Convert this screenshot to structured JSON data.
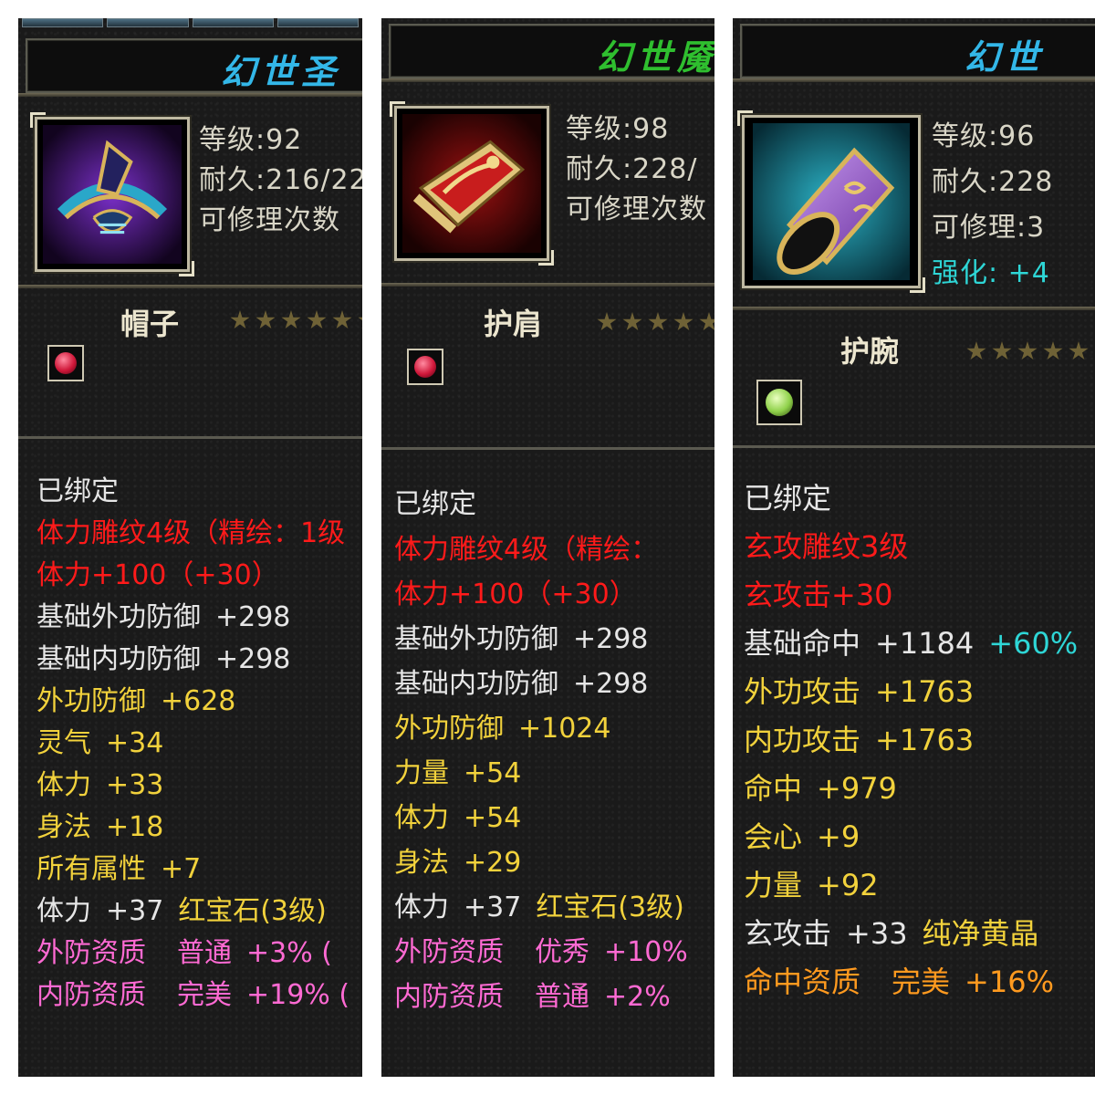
{
  "panels": [
    {
      "title": "幻世圣",
      "title_color": "#33b7e8",
      "level": "等级:92",
      "durability": "耐久:216/22",
      "repair": "可修理次数",
      "slot": "帽子",
      "gem_color": "#d0183a",
      "bind": "已绑定",
      "attrs": [
        {
          "name": "体力雕纹4级（精绘：1级",
          "value": "",
          "extra": "",
          "color": "red"
        },
        {
          "name": "体力+100（+30）",
          "value": "",
          "extra": "",
          "color": "red"
        },
        {
          "name": "基础外功防御",
          "value": "+298",
          "extra": "",
          "color": "white"
        },
        {
          "name": "基础内功防御",
          "value": "+298",
          "extra": "",
          "color": "white"
        },
        {
          "name": "外功防御",
          "value": "+628",
          "extra": "",
          "color": "gold"
        },
        {
          "name": "灵气",
          "value": "+34",
          "extra": "",
          "color": "gold"
        },
        {
          "name": "体力",
          "value": "+33",
          "extra": "",
          "color": "gold"
        },
        {
          "name": "身法",
          "value": "+18",
          "extra": "",
          "color": "gold"
        },
        {
          "name": "所有属性",
          "value": "+7",
          "extra": "",
          "color": "gold"
        },
        {
          "name": "体力",
          "value": "+37",
          "extra": "红宝石(3级)",
          "color": "white"
        },
        {
          "name": "外防资质",
          "value": "普通",
          "extra": "+3% (",
          "color": "pink"
        },
        {
          "name": "内防资质",
          "value": "完美",
          "extra": "+19% (",
          "color": "pink"
        }
      ]
    },
    {
      "title": "幻世魇",
      "title_color": "#2fbf2f",
      "level": "等级:98",
      "durability": "耐久:228/",
      "repair": "可修理次数",
      "slot": "护肩",
      "gem_color": "#d0183a",
      "bind": "已绑定",
      "attrs": [
        {
          "name": "体力雕纹4级（精绘：",
          "value": "",
          "extra": "",
          "color": "red"
        },
        {
          "name": "体力+100（+30）",
          "value": "",
          "extra": "",
          "color": "red"
        },
        {
          "name": "基础外功防御",
          "value": "+298",
          "extra": "",
          "color": "white"
        },
        {
          "name": "基础内功防御",
          "value": "+298",
          "extra": "",
          "color": "white"
        },
        {
          "name": "外功防御",
          "value": "+1024",
          "extra": "",
          "color": "gold"
        },
        {
          "name": "力量",
          "value": "+54",
          "extra": "",
          "color": "gold"
        },
        {
          "name": "体力",
          "value": "+54",
          "extra": "",
          "color": "gold"
        },
        {
          "name": "身法",
          "value": "+29",
          "extra": "",
          "color": "gold"
        },
        {
          "name": "体力",
          "value": "+37",
          "extra": "红宝石(3级)",
          "color": "white"
        },
        {
          "name": "外防资质",
          "value": "优秀",
          "extra": "+10%",
          "color": "pink"
        },
        {
          "name": "内防资质",
          "value": "普通",
          "extra": "+2%",
          "color": "pink"
        }
      ]
    },
    {
      "title": "幻世",
      "title_color": "#33b7e8",
      "level": "等级:96",
      "durability": "耐久:228",
      "repair": "可修理:3",
      "enhance": "强化: +4",
      "slot": "护腕",
      "gem_color": "#8fd14a",
      "bind": "已绑定",
      "attrs": [
        {
          "name": "玄攻雕纹3级",
          "value": "",
          "extra": "",
          "color": "red"
        },
        {
          "name": "玄攻击+30",
          "value": "",
          "extra": "",
          "color": "red"
        },
        {
          "name": "基础命中",
          "value": "+1184",
          "extra": "+60%",
          "color": "white"
        },
        {
          "name": "外功攻击",
          "value": "+1763",
          "extra": "",
          "color": "gold"
        },
        {
          "name": "内功攻击",
          "value": "+1763",
          "extra": "",
          "color": "gold"
        },
        {
          "name": "命中",
          "value": "+979",
          "extra": "",
          "color": "gold"
        },
        {
          "name": "会心",
          "value": "+9",
          "extra": "",
          "color": "gold"
        },
        {
          "name": "力量",
          "value": "+92",
          "extra": "",
          "color": "gold"
        },
        {
          "name": "玄攻击",
          "value": "+33",
          "extra": "纯净黄晶",
          "color": "white"
        },
        {
          "name": "命中资质",
          "value": "完美",
          "extra": "+16%",
          "color": "orange"
        }
      ]
    }
  ]
}
